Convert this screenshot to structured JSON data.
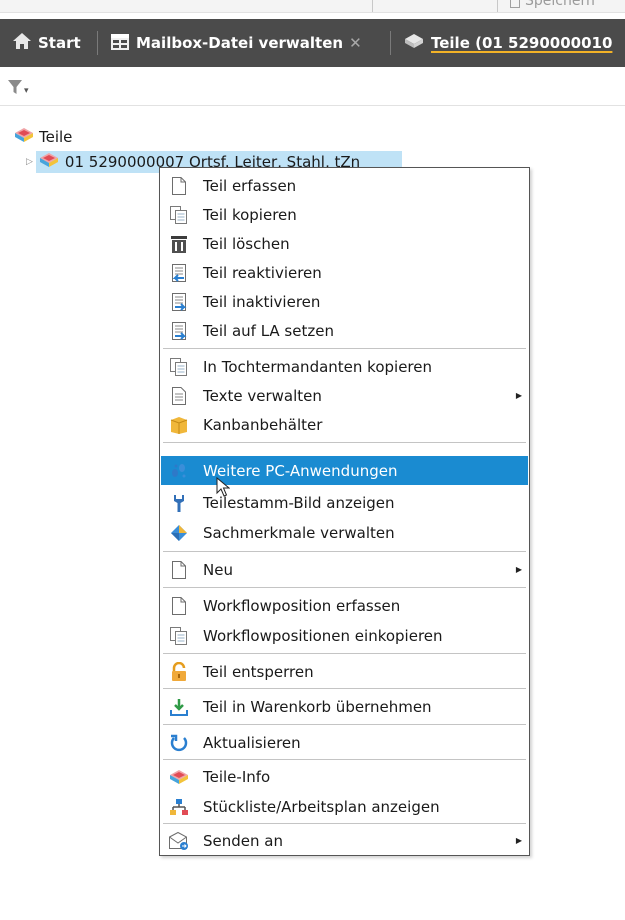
{
  "toolbar": {
    "save_label": "Speichern"
  },
  "tabs": [
    {
      "label": "Start"
    },
    {
      "label": "Mailbox-Datei verwalten",
      "close": "✕"
    },
    {
      "label": "Teile (01 5290000010"
    }
  ],
  "filter": {
    "caret": "▾"
  },
  "tree": {
    "root_label": "Teile",
    "child_label": "01 5290000007 Ortsf. Leiter, Stahl, tZn",
    "expander": "▷"
  },
  "menu": {
    "items": [
      {
        "label": "Teil erfassen",
        "icon": "page-icon"
      },
      {
        "label": "Teil kopieren",
        "icon": "copy-icon"
      },
      {
        "label": "Teil löschen",
        "icon": "trash-icon"
      },
      {
        "label": "Teil reaktivieren",
        "icon": "reactivate-icon"
      },
      {
        "label": "Teil inaktivieren",
        "icon": "deactivate-icon"
      },
      {
        "label": "Teil auf LA setzen",
        "icon": "set-la-icon"
      },
      {
        "label": "In Tochtermandanten kopieren",
        "icon": "copy-icon"
      },
      {
        "label": "Texte verwalten",
        "icon": "document-icon",
        "submenu": true
      },
      {
        "label": "Kanbanbehälter",
        "icon": "box-icon"
      },
      {
        "label": "Weitere PC-Anwendungen",
        "icon": "footprints-icon",
        "highlighted": true
      },
      {
        "label": "Teilestamm-Bild anzeigen",
        "icon": "wrench-icon"
      },
      {
        "label": "Sachmerkmale verwalten",
        "icon": "diamond-icon"
      },
      {
        "label": "Neu",
        "icon": "page-icon",
        "submenu": true
      },
      {
        "label": "Workflowposition erfassen",
        "icon": "page-icon"
      },
      {
        "label": "Workflowpositionen einkopieren",
        "icon": "copy-icon"
      },
      {
        "label": "Teil entsperren",
        "icon": "unlock-icon"
      },
      {
        "label": "Teil in Warenkorb übernehmen",
        "icon": "download-tray-icon"
      },
      {
        "label": "Aktualisieren",
        "icon": "refresh-icon"
      },
      {
        "label": "Teile-Info",
        "icon": "parts-icon"
      },
      {
        "label": "Stückliste/Arbeitsplan anzeigen",
        "icon": "hierarchy-icon"
      },
      {
        "label": "Senden an",
        "icon": "send-mail-icon",
        "submenu": true
      }
    ],
    "submenu_arrow": "▶"
  },
  "colors": {
    "tab_bar": "#4b4b4b",
    "tab_accent": "#f2b227",
    "selection": "#bfe2f6",
    "menu_highlight": "#1a8bd1"
  }
}
